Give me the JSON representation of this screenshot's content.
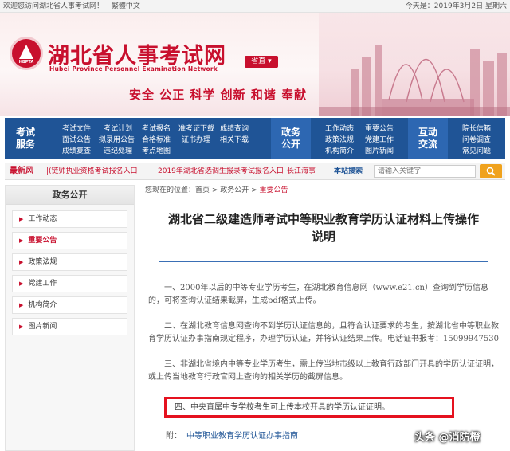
{
  "topbar": {
    "welcome": "欢迎您访问湖北省人事考试网！",
    "lang": "| 繁體中文",
    "date": "今天是：2019年3月2日 星期六"
  },
  "banner": {
    "title": "湖北省人事考试网",
    "subtitle_en": "Hubei Province Personnel Examination Network",
    "emblem_abbr": "HBPTA",
    "province_btn": "省直 ▾",
    "slogan": "安全 公正 科学 创新 和谐 奉献"
  },
  "nav": {
    "exam_service": {
      "title": [
        "考试",
        "服务"
      ],
      "links": [
        "考试文件",
        "考试计划",
        "考试报名",
        "准考证下载",
        "成绩查询",
        "面试公告",
        "拟录用公告",
        "合格标准",
        "证书办理",
        "相关下载",
        "成绩复查",
        "违纪处理",
        "考点地图"
      ]
    },
    "gov_affairs": {
      "title": [
        "政务",
        "公开"
      ],
      "links": [
        "工作动态",
        "重要公告",
        "政策法规",
        "党建工作",
        "机构简介",
        "图片新闻"
      ]
    },
    "interaction": {
      "title": [
        "互动",
        "交流"
      ],
      "links": [
        "院长信箱",
        "问卷调查",
        "常见问题"
      ]
    }
  },
  "latest": {
    "label": "最新风",
    "items": [
      "|(链师执业资格考试报名入口",
      "2019年湖北省选调生报录考试报名入口",
      "长江海事"
    ],
    "search_label": "本站搜索",
    "search_placeholder": "请输入关键字"
  },
  "sidebar": {
    "heading": "政务公开",
    "items": [
      {
        "label": "工作动态",
        "active": false
      },
      {
        "label": "重要公告",
        "active": true
      },
      {
        "label": "政策法规",
        "active": false
      },
      {
        "label": "党建工作",
        "active": false
      },
      {
        "label": "机构简介",
        "active": false
      },
      {
        "label": "图片新闻",
        "active": false
      }
    ]
  },
  "content": {
    "breadcrumb": {
      "prefix": "您现在的位置：首页 > 政务公开 > ",
      "current": "重要公告"
    },
    "title_line1": "湖北省二级建造师考试中等职业教育学历认证材料上传操作",
    "title_line2": "说明",
    "paragraphs": [
      "一、2000年以后的中等专业学历考生，在湖北教育信息网（www.e21.cn）查询到学历信息的，可将查询认证结果截屏，生成pdf格式上传。",
      "二、在湖北教育信息网查询不到学历认证信息的，且符合认证要求的考生，按湖北省中等职业教育学历认证办事指南规定程序，办理学历认证，并将认证结果上传。电话证书报考：15099947530",
      "三、非湖北省境内中等专业学历考生，需上传当地市级以上教育行政部门开具的学历认证证明，或上传当地教育行政官网上查询的相关学历的截屏信息。"
    ],
    "highlight": "四、中央直属中专学校考生可上传本校开具的学历认证证明。",
    "attachment_label": "附：",
    "attachment_link": "中等职业教育学历认证办事指南"
  },
  "watermark": "头条 @消防橙",
  "colors": {
    "brand_red": "#c8102e",
    "nav_blue": "#1f5496",
    "highlight_red": "#e5121f",
    "search_orange": "#f0a21d"
  }
}
